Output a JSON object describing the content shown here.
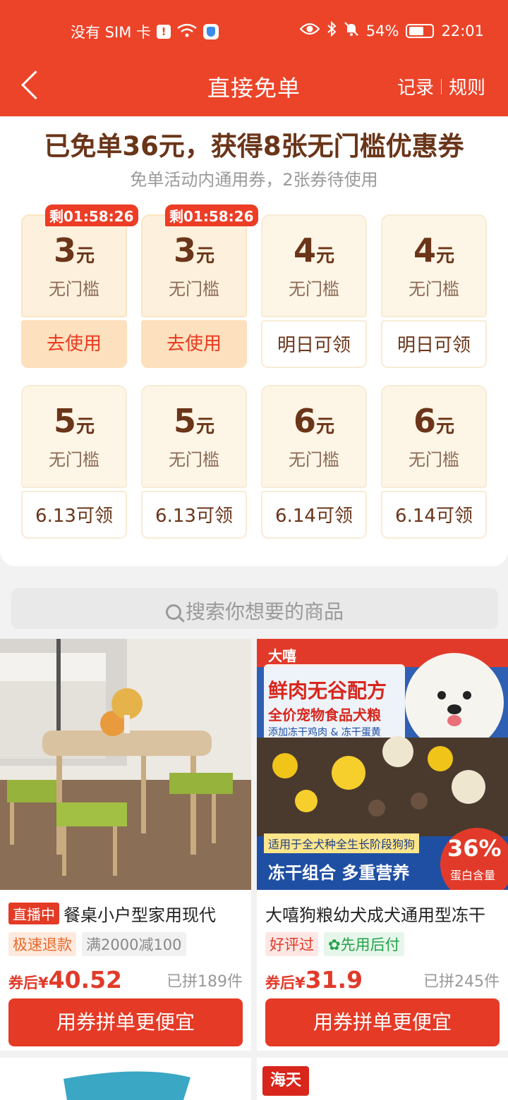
{
  "status_bar": {
    "carrier": "没有 SIM 卡",
    "battery": "54%",
    "time": "22:01"
  },
  "nav": {
    "title": "直接免单",
    "records": "记录",
    "rules": "规则"
  },
  "summary": {
    "headline": "已免单36元，获得8张无门槛优惠券",
    "subline": "免单活动内通用券，2张券待使用"
  },
  "coupons": [
    {
      "amount": "3",
      "unit": "元",
      "condition": "无门槛",
      "action": "去使用",
      "timer": "剩01:58:26",
      "active": true
    },
    {
      "amount": "3",
      "unit": "元",
      "condition": "无门槛",
      "action": "去使用",
      "timer": "剩01:58:26",
      "active": true
    },
    {
      "amount": "4",
      "unit": "元",
      "condition": "无门槛",
      "action": "明日可领",
      "active": false
    },
    {
      "amount": "4",
      "unit": "元",
      "condition": "无门槛",
      "action": "明日可领",
      "active": false
    },
    {
      "amount": "5",
      "unit": "元",
      "condition": "无门槛",
      "action": "6.13可领",
      "active": false
    },
    {
      "amount": "5",
      "unit": "元",
      "condition": "无门槛",
      "action": "6.13可领",
      "active": false
    },
    {
      "amount": "6",
      "unit": "元",
      "condition": "无门槛",
      "action": "6.14可领",
      "active": false
    },
    {
      "amount": "6",
      "unit": "元",
      "condition": "无门槛",
      "action": "6.14可领",
      "active": false
    }
  ],
  "search": {
    "placeholder": "搜索你想要的商品"
  },
  "products": [
    {
      "live_tag": "直播中",
      "title": "餐桌小户型家用现代",
      "tags": [
        "极速退款",
        "满2000减100"
      ],
      "price_prefix": "券后¥",
      "price": "40.52",
      "sold": "已拼189件",
      "button": "用券拼单更便宜"
    },
    {
      "title": "大嘻狗粮幼犬成犬通用型冻干",
      "tags": [
        "好评过",
        "先用后付"
      ],
      "price_prefix": "券后¥",
      "price": "31.9",
      "sold": "已拼245件",
      "button": "用券拼单更便宜",
      "image_text": {
        "brand": "大嘻",
        "line1": "鲜肉无谷配方",
        "line2": "全价宠物食品犬粮",
        "line3": "添加冻干鸡肉 & 冻干蛋黄",
        "line4": "适用于全犬种全生长阶段狗狗",
        "line5": "冻干组合 多重营养",
        "badge_pct": "36%",
        "badge_text": "蛋白含量"
      }
    },
    {
      "brand": "海天"
    }
  ]
}
